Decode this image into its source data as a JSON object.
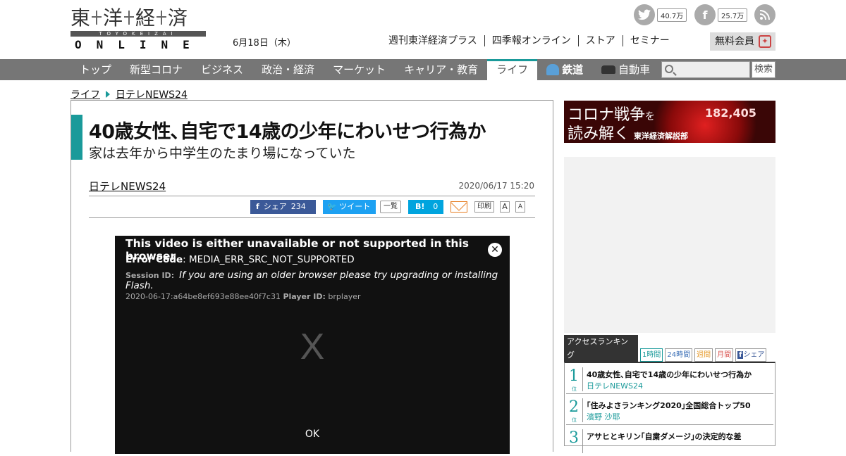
{
  "header": {
    "logo_kanji": [
      "東",
      "洋",
      "経",
      "済"
    ],
    "logo_romaji": "TOYOKEIZAI",
    "logo_online": "ONLINE",
    "date": "6月18日（木）",
    "twitter_count": "40.7万",
    "facebook_count": "25.7万",
    "links": [
      "週刊東洋経済プラス",
      "四季報オンライン",
      "ストア",
      "セミナー"
    ],
    "member_label": "無料会員"
  },
  "nav": {
    "items": [
      "トップ",
      "新型コロナ",
      "ビジネス",
      "政治・経済",
      "マーケット",
      "キャリア・教育",
      "ライフ"
    ],
    "rail_label": "鉄道",
    "car_label": "自動車",
    "search_placeholder": "",
    "search_button": "検索"
  },
  "breadcrumb": {
    "section": "ライフ",
    "source": "日テレNEWS24"
  },
  "article": {
    "title": "40歳女性､自宅で14歳の少年にわいせつ行為か",
    "subtitle": "家は去年から中学生のたまり場になっていた",
    "source": "日テレNEWS24",
    "date": "2020/06/17 15:20",
    "share": {
      "fb_label": "シェア",
      "fb_count": "234",
      "tweet_label": "ツイート",
      "list_label": "一覧",
      "hatena_count": "0",
      "print_label": "印刷",
      "font_a1": "A",
      "font_a2": "A"
    }
  },
  "video": {
    "error_title": "This video is either unavailable or not supported in this browser",
    "error_code_label": "Error Code",
    "error_code": ": MEDIA_ERR_SRC_NOT_SUPPORTED",
    "session_label": "Session ID:",
    "session_msg": "If you are using an older browser please try upgrading or installing Flash.",
    "session_id": "2020-06-17:a64be8ef693e88ee40f7c31",
    "player_label": "Player ID:",
    "player_id": "brplayer",
    "big_x": "X",
    "ok": "OK"
  },
  "banner": {
    "line1a": "コロナ戦争",
    "line1b": "を",
    "line2": "読み解く",
    "line2_small": "東洋経済解説部",
    "num": "182,405"
  },
  "ranking": {
    "title": "アクセスランキング",
    "tabs": [
      "1時間",
      "24時間",
      "週間",
      "月間",
      "シェア"
    ],
    "rank_suffix": "位",
    "items": [
      {
        "rank": "1",
        "title": "40歳女性､自宅で14歳の少年にわいせつ行為か",
        "author": "日テレNEWS24"
      },
      {
        "rank": "2",
        "title": "｢住みよさランキング2020｣全国総合トップ50",
        "author": "濱野 沙耶"
      },
      {
        "rank": "3",
        "title": "アサヒとキリン｢自粛ダメージ｣の決定的な差",
        "author": ""
      }
    ]
  },
  "colors": {
    "accent": "#1a9a9a",
    "nav_bg": "#767676"
  }
}
